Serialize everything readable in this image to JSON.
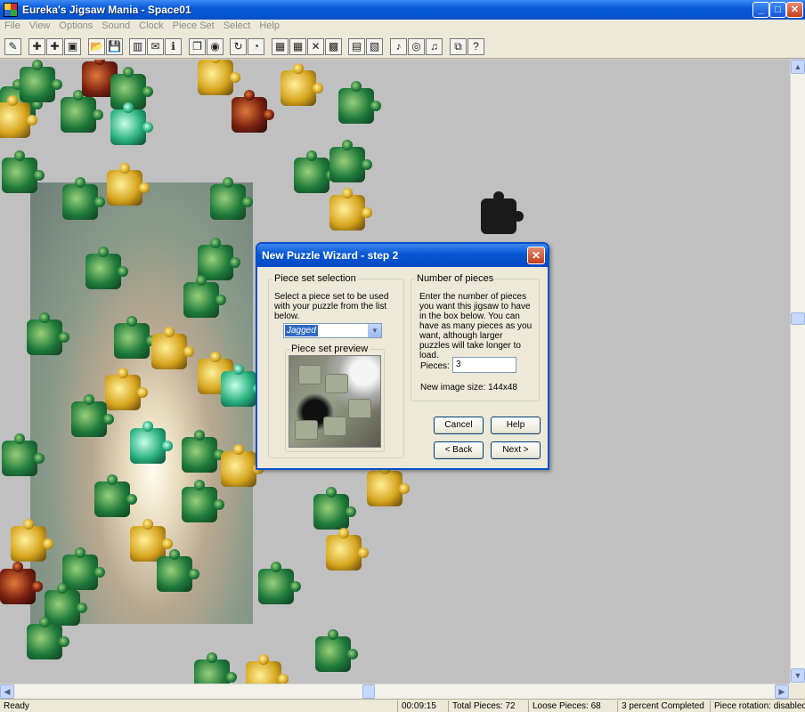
{
  "window": {
    "title": "Eureka's Jigsaw Mania - Space01",
    "buttons": {
      "minimize": "_",
      "maximize": "□",
      "close": "✕"
    }
  },
  "menu": [
    "File",
    "View",
    "Options",
    "Sound",
    "Clock",
    "Piece Set",
    "Select",
    "Help"
  ],
  "toolbar": {
    "icons": [
      "wand-icon",
      "pieces-red-icon",
      "pieces-red-alt-icon",
      "image-icon",
      "open-folder-icon",
      "save-disk-icon",
      "building-icon",
      "mail-icon",
      "info-icon",
      "copy-icon",
      "color-wheel-icon",
      "rotate-icon",
      "clock-icon",
      "grid-icon",
      "grid-alt-icon",
      "close-x-icon",
      "pattern-icon",
      "picture-icon",
      "frame-icon",
      "music-note-icon",
      "cd-icon",
      "sound-icon",
      "window-icon",
      "help-icon"
    ],
    "glyphs": [
      "✎",
      "✚",
      "✚",
      "▣",
      "📂",
      "💾",
      "▥",
      "✉",
      "ℹ",
      "❐",
      "◉",
      "↻",
      "◔",
      "▦",
      "▦",
      "✕",
      "▩",
      "▤",
      "▧",
      "♪",
      "◎",
      "♫",
      "⧉",
      "?"
    ]
  },
  "dialog": {
    "title": "New Puzzle Wizard - step 2",
    "close_glyph": "✕",
    "piece_set": {
      "legend": "Piece set selection",
      "description": "Select a piece set to be used with your puzzle from the list below.",
      "selected": "Jagged",
      "preview_legend": "Piece set preview"
    },
    "pieces": {
      "legend": "Number of pieces",
      "description": "Enter the number of pieces you want this jigsaw to have in the box below. You can have as many pieces as you want, although larger puzzles will take longer to load.",
      "label": "Pieces:",
      "value": "3",
      "image_size": "New image size: 144x48"
    },
    "buttons": {
      "cancel": "Cancel",
      "help": "Help",
      "back": "< Back",
      "next": "Next >"
    }
  },
  "status": {
    "ready": "Ready",
    "time": "00:09:15",
    "total": "Total Pieces: 72",
    "loose": "Loose Pieces: 68",
    "completed": "3 percent Completed",
    "rotation": "Piece rotation: disabled"
  },
  "scroll": {
    "up": "▲",
    "down": "▼",
    "left": "◀",
    "right": "▶"
  }
}
